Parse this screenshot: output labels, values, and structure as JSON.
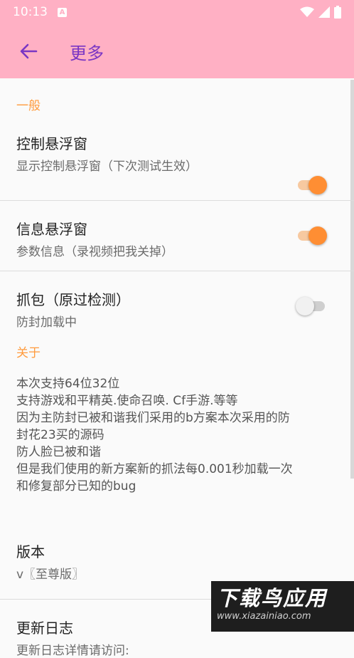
{
  "status_bar": {
    "time": "10:13",
    "notification_glyph": "A",
    "icons": [
      "wifi-icon",
      "signal-icon",
      "battery-icon"
    ]
  },
  "toolbar": {
    "title": "更多",
    "back_icon": "arrow-left-icon",
    "bg_color": "#ffb0c4",
    "title_color": "#7a36c4"
  },
  "general": {
    "header": "一般",
    "items": [
      {
        "title": "控制悬浮窗",
        "summary": "显示控制悬浮窗（下次测试生效）",
        "enabled": true
      },
      {
        "title": "信息悬浮窗",
        "summary": "参数信息（录视频把我关掉）",
        "enabled": true
      },
      {
        "title": "抓包（原过检测）",
        "summary": "防封加载中",
        "enabled": false
      }
    ]
  },
  "about": {
    "header": "关于",
    "lines": [
      "本次支持64位32位",
      "支持游戏和平精英.使命召唤. Cf手游.等等",
      "因为主防封已被和谐我们采用的b方案本次采用的防",
      "封花23买的源码",
      "防人脸已被和谐",
      "但是我们使用的新方案新的抓法每0.001秒加载一次",
      "和修复部分已知的bug"
    ]
  },
  "version": {
    "title": "版本",
    "value": "v〖至尊版〗"
  },
  "changelog": {
    "title": "更新日志",
    "summary": "更新日志详情请访问:"
  },
  "watermark": {
    "cn": "下载鸟应用",
    "url": "www.xiazainiao.com"
  },
  "colors": {
    "accent": "#ff8e33",
    "category": "#ff9b3d"
  }
}
